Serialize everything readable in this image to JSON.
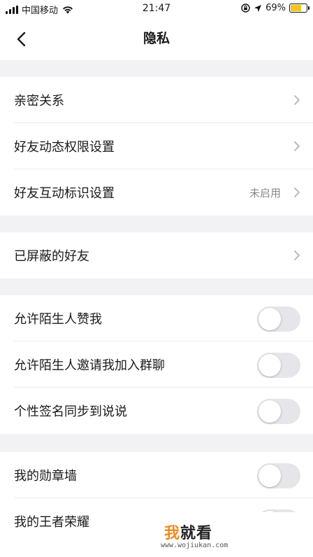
{
  "status_bar": {
    "carrier": "中国移动",
    "time": "21:47",
    "battery_percent": "69%",
    "battery_level": 0.69,
    "battery_color": "#f5c518"
  },
  "nav": {
    "title": "隐私",
    "back_icon": "chevron-left-icon"
  },
  "groups": [
    {
      "rows": [
        {
          "label": "亲密关系",
          "accessory": "chevron"
        },
        {
          "label": "好友动态权限设置",
          "accessory": "chevron"
        },
        {
          "label": "好友互动标识设置",
          "value": "未启用",
          "accessory": "chevron"
        }
      ]
    },
    {
      "rows": [
        {
          "label": "已屏蔽的好友",
          "accessory": "chevron"
        }
      ]
    },
    {
      "rows": [
        {
          "label": "允许陌生人赞我",
          "accessory": "toggle",
          "on": false
        },
        {
          "label": "允许陌生人邀请我加入群聊",
          "accessory": "toggle",
          "on": false
        },
        {
          "label": "个性签名同步到说说",
          "accessory": "toggle",
          "on": false
        }
      ]
    },
    {
      "rows": [
        {
          "label": "我的勋章墙",
          "accessory": "toggle",
          "on": false
        },
        {
          "label": "我的王者荣耀",
          "accessory": "toggle",
          "on": false
        }
      ]
    }
  ],
  "watermark": {
    "logo_accent": "我",
    "logo_rest": "就看",
    "url": "www.wojiukan.com"
  },
  "colors": {
    "background": "#f2f2f4",
    "toggle_off": "#e6e6ea",
    "watermark_accent": "#f08a1c"
  }
}
